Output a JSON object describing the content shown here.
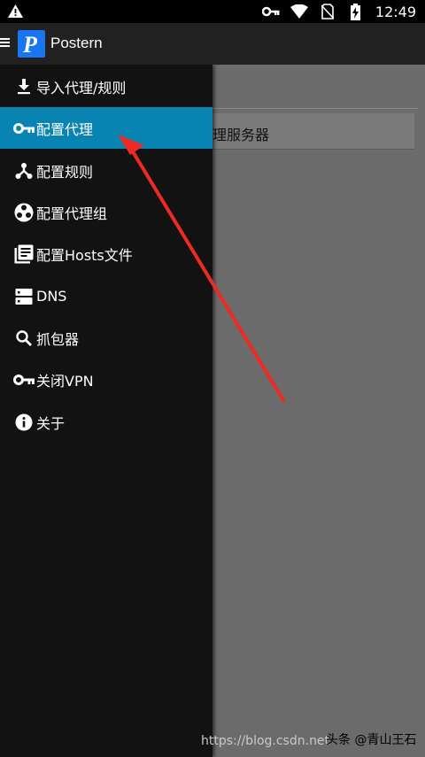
{
  "status_bar": {
    "time": "12:49",
    "icons": [
      "warning-icon",
      "key-icon",
      "wifi-icon",
      "no-sim-icon",
      "battery-charging-icon"
    ]
  },
  "app_bar": {
    "title": "Postern",
    "logo_letter": "P",
    "brand_color": "#1976f2"
  },
  "drawer": {
    "active_color": "#0784b1",
    "items": [
      {
        "label": "导入代理/规则",
        "icon": "download-icon"
      },
      {
        "label": "配置代理",
        "icon": "key-icon",
        "active": true
      },
      {
        "label": "配置规则",
        "icon": "share-icon"
      },
      {
        "label": "配置代理组",
        "icon": "group-icon"
      },
      {
        "label": "配置Hosts文件",
        "icon": "library-icon"
      },
      {
        "label": "DNS",
        "icon": "dns-icon"
      },
      {
        "label": "抓包器",
        "icon": "search-icon"
      },
      {
        "label": "关闭VPN",
        "icon": "key-icon"
      },
      {
        "label": "关于",
        "icon": "info-icon"
      }
    ]
  },
  "background": {
    "card_label": "理服务器"
  },
  "watermark": {
    "url": "https://blog.csdn.net",
    "author": "头条 @青山王石"
  }
}
